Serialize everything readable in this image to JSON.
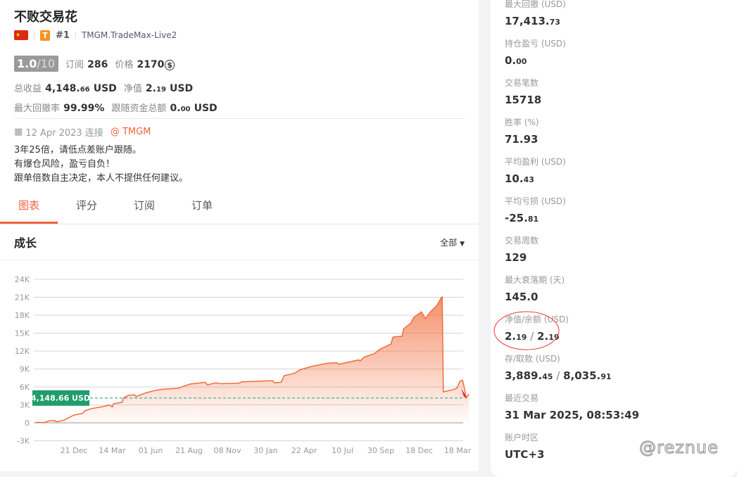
{
  "profile": {
    "name": "不败交易花",
    "flag": "🇨🇳",
    "badge": "T",
    "rank": "#1",
    "server": "TMGM.TradeMax-Live2",
    "score": "1.0",
    "score_max": "/10",
    "subs_label": "订阅",
    "subs": "286",
    "price_label": "价格",
    "price": "2170",
    "total_label": "总收益",
    "total_int": "4,148.",
    "total_dec": "66",
    "total_unit": "USD",
    "equity_label": "净值",
    "equity_int": "2.",
    "equity_dec": "19",
    "equity_unit": "USD",
    "dd_label": "最大回撤率",
    "dd": "99.99%",
    "follow_label": "跟随资金总额",
    "follow_int": "0.",
    "follow_dec": "00",
    "follow_unit": "USD",
    "connected": "12 Apr 2023 连接",
    "broker": "@ TMGM",
    "desc": [
      "3年25倍，请低点差账户跟随。",
      "有爆仓风险，盈亏自负！",
      "跟单倍数自主决定，本人不提供任何建议。"
    ]
  },
  "tabs": [
    {
      "label": "图表",
      "active": true
    },
    {
      "label": "评分"
    },
    {
      "label": "订阅"
    },
    {
      "label": "订单"
    }
  ],
  "chart_header": {
    "title": "成长",
    "range": "全部"
  },
  "chart_data": {
    "type": "area",
    "title": "成长",
    "x_ticks": [
      "21 Dec",
      "14 Mar",
      "01 Jun",
      "21 Aug",
      "08 Nov",
      "30 Jan",
      "22 Apr",
      "10 Jul",
      "30 Sep",
      "18 Dec",
      "18 Mar"
    ],
    "y_ticks": [
      "24K",
      "21K",
      "18K",
      "15K",
      "12K",
      "9K",
      "6K",
      "3K",
      "0",
      "-3K"
    ],
    "y_tick_values": [
      24000,
      21000,
      18000,
      15000,
      12000,
      9000,
      6000,
      3000,
      0,
      -3000
    ],
    "ylim": [
      -3000,
      24000
    ],
    "x_unit": "tick index (0 = 21 Dec)",
    "reference": {
      "value": 4148.66,
      "label": "4,148.66 USD",
      "color": "#1f9d6b"
    },
    "line_color": "#f26b3a",
    "points": [
      [
        -1.0,
        80
      ],
      [
        -0.78,
        40
      ],
      [
        -0.66,
        310
      ],
      [
        -0.5,
        390
      ],
      [
        -0.46,
        160
      ],
      [
        -0.26,
        430
      ],
      [
        0,
        1290
      ],
      [
        0.22,
        1560
      ],
      [
        0.3,
        2060
      ],
      [
        0.46,
        2380
      ],
      [
        0.7,
        2650
      ],
      [
        0.94,
        2960
      ],
      [
        1.0,
        2650
      ],
      [
        1.03,
        3190
      ],
      [
        1.26,
        3430
      ],
      [
        1.3,
        4200
      ],
      [
        1.42,
        4600
      ],
      [
        1.58,
        4680
      ],
      [
        1.62,
        4400
      ],
      [
        1.9,
        5060
      ],
      [
        2.14,
        5450
      ],
      [
        2.3,
        5610
      ],
      [
        2.7,
        5760
      ],
      [
        3.02,
        6470
      ],
      [
        3.42,
        6780
      ],
      [
        3.48,
        6350
      ],
      [
        3.7,
        6700
      ],
      [
        3.82,
        6540
      ],
      [
        4.3,
        6620
      ],
      [
        4.38,
        6860
      ],
      [
        5.18,
        7050
      ],
      [
        5.22,
        6700
      ],
      [
        5.4,
        6780
      ],
      [
        5.48,
        7910
      ],
      [
        5.74,
        8260
      ],
      [
        5.9,
        8880
      ],
      [
        6.22,
        9470
      ],
      [
        6.62,
        9970
      ],
      [
        6.86,
        10050
      ],
      [
        6.9,
        9780
      ],
      [
        7.42,
        10520
      ],
      [
        7.46,
        10360
      ],
      [
        7.58,
        11030
      ],
      [
        7.82,
        11530
      ],
      [
        7.98,
        12310
      ],
      [
        8.26,
        13170
      ],
      [
        8.32,
        14340
      ],
      [
        8.56,
        14490
      ],
      [
        8.59,
        15700
      ],
      [
        8.78,
        16670
      ],
      [
        8.86,
        17650
      ],
      [
        9.06,
        18550
      ],
      [
        9.16,
        17450
      ],
      [
        9.3,
        18620
      ],
      [
        9.46,
        19600
      ],
      [
        9.58,
        20960
      ],
      [
        9.6,
        21040
      ],
      [
        9.63,
        5180
      ],
      [
        9.82,
        5450
      ],
      [
        9.98,
        5770
      ],
      [
        10.06,
        6940
      ],
      [
        10.13,
        7130
      ],
      [
        10.18,
        5770
      ],
      [
        10.22,
        4210
      ],
      [
        10.3,
        4790
      ]
    ]
  },
  "stats": [
    {
      "label": "最大回撤 (USD)",
      "int": "17,413.",
      "dec": "73"
    },
    {
      "label": "持仓盈亏 (USD)",
      "int": "0.",
      "dec": "00"
    },
    {
      "label": "交易笔数",
      "int": "15718",
      "dec": ""
    },
    {
      "label": "胜率 (%)",
      "int": "71.93",
      "dec": ""
    },
    {
      "label": "平均盈利 (USD)",
      "int": "10.",
      "dec": "43"
    },
    {
      "label": "平均亏损 (USD)",
      "int": "-25.",
      "dec": "81"
    },
    {
      "label": "交易周数",
      "int": "129",
      "dec": ""
    },
    {
      "label": "最大衰落期 (天)",
      "int": "145.0",
      "dec": ""
    },
    {
      "label": "净值/余额 (USD)",
      "int": "2.",
      "dec": "19",
      "sep": " / ",
      "int2": "2.",
      "dec2": "19"
    },
    {
      "label": "存/取款 (USD)",
      "int": "3,889.",
      "dec": "45",
      "sep": " / ",
      "int2": "8,035.",
      "dec2": "91"
    },
    {
      "label": "最近交易",
      "int": "31 Mar 2025, 08:53:49",
      "dec": ""
    },
    {
      "label": "账户时区",
      "int": "UTC+3",
      "dec": ""
    }
  ],
  "watermark": "@reznue",
  "colors": {
    "accent": "#f0643c",
    "annotation": "#e33"
  }
}
